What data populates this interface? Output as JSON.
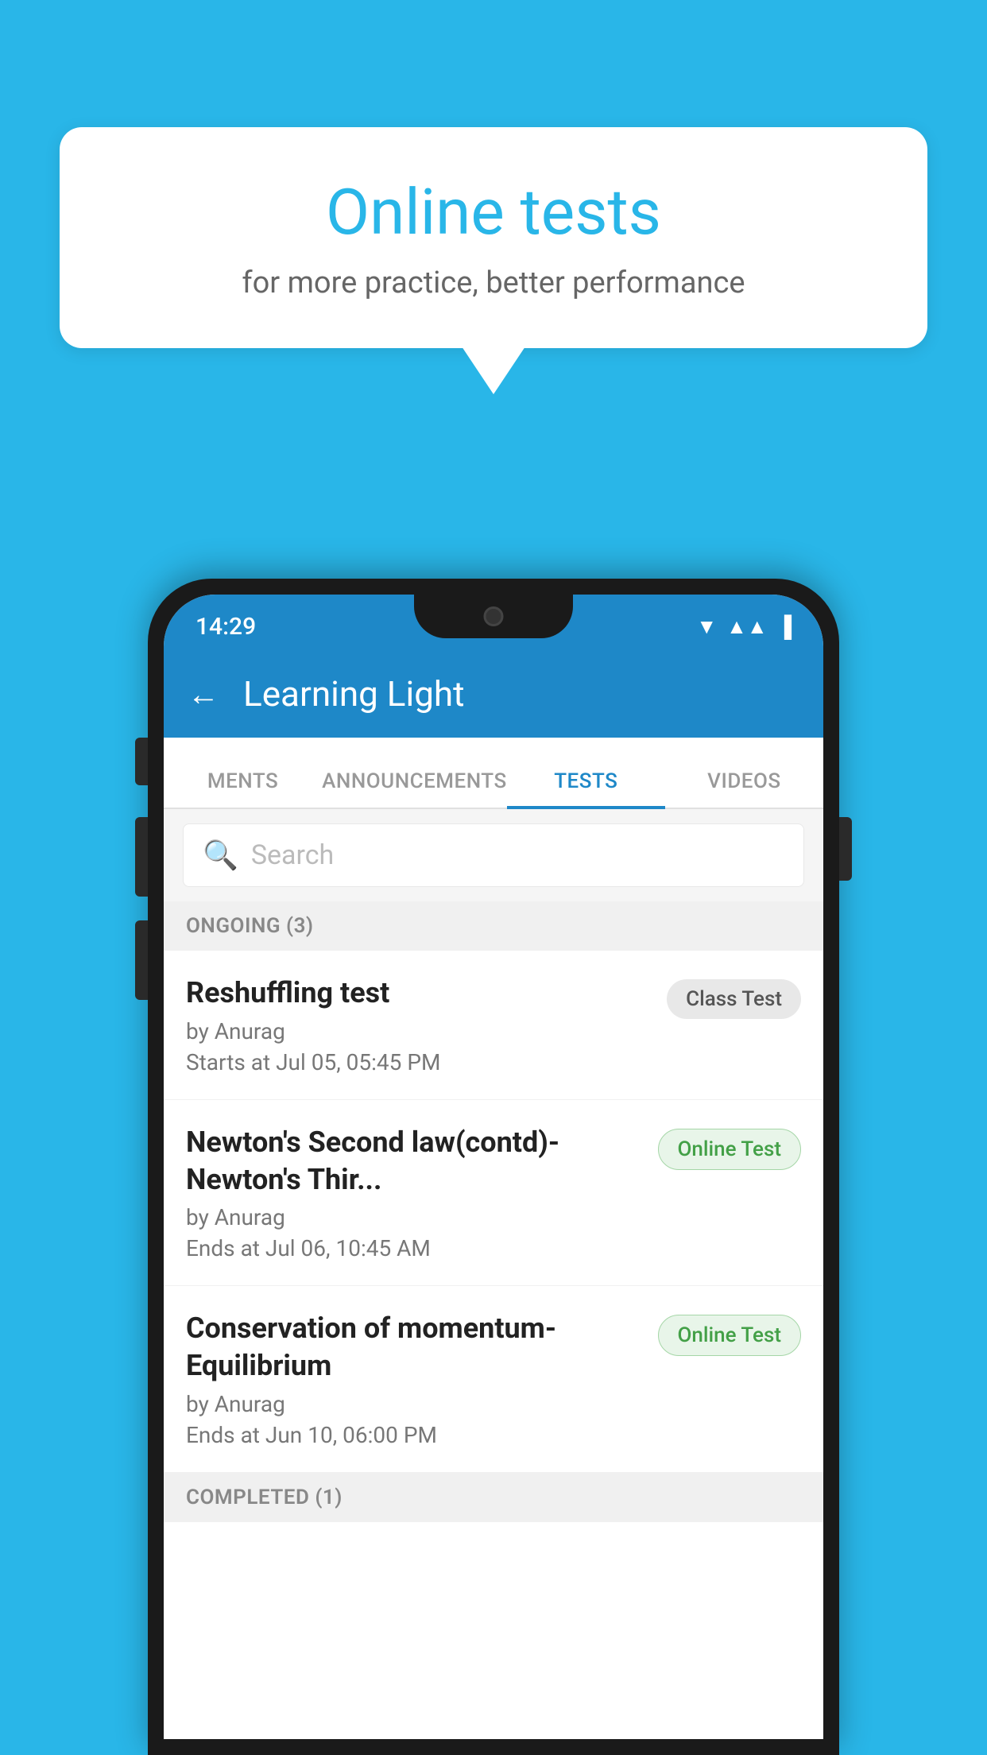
{
  "background": {
    "color": "#29b6e8"
  },
  "speech_bubble": {
    "title": "Online tests",
    "subtitle": "for more practice, better performance"
  },
  "phone": {
    "status_bar": {
      "time": "14:29",
      "icons": [
        "wifi",
        "signal",
        "battery"
      ]
    },
    "app_bar": {
      "title": "Learning Light",
      "back_label": "←"
    },
    "tabs": [
      {
        "label": "MENTS",
        "active": false
      },
      {
        "label": "ANNOUNCEMENTS",
        "active": false
      },
      {
        "label": "TESTS",
        "active": true
      },
      {
        "label": "VIDEOS",
        "active": false
      }
    ],
    "search": {
      "placeholder": "Search"
    },
    "ongoing_section": {
      "label": "ONGOING (3)"
    },
    "tests": [
      {
        "name": "Reshuffling test",
        "author": "by Anurag",
        "time_label": "Starts at",
        "time": "Jul 05, 05:45 PM",
        "badge": "Class Test",
        "badge_type": "class"
      },
      {
        "name": "Newton's Second law(contd)-Newton's Thir...",
        "author": "by Anurag",
        "time_label": "Ends at",
        "time": "Jul 06, 10:45 AM",
        "badge": "Online Test",
        "badge_type": "online"
      },
      {
        "name": "Conservation of momentum-Equilibrium",
        "author": "by Anurag",
        "time_label": "Ends at",
        "time": "Jun 10, 06:00 PM",
        "badge": "Online Test",
        "badge_type": "online"
      }
    ],
    "completed_section": {
      "label": "COMPLETED (1)"
    }
  }
}
